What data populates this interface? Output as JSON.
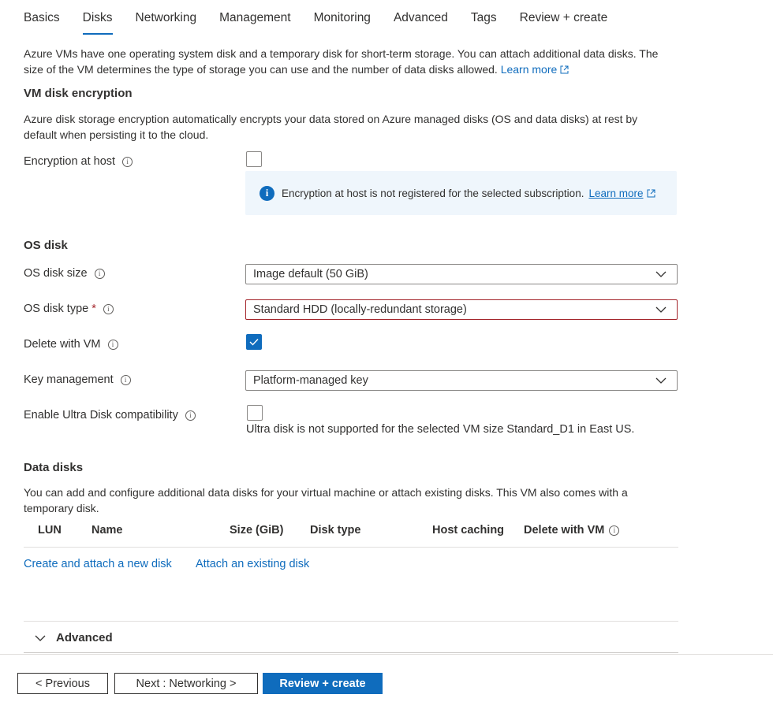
{
  "tabs": [
    {
      "label": "Basics"
    },
    {
      "label": "Disks"
    },
    {
      "label": "Networking"
    },
    {
      "label": "Management"
    },
    {
      "label": "Monitoring"
    },
    {
      "label": "Advanced"
    },
    {
      "label": "Tags"
    },
    {
      "label": "Review + create"
    }
  ],
  "active_tab": "Disks",
  "intro": {
    "text": "Azure VMs have one operating system disk and a temporary disk for short-term storage. You can attach additional data disks. The size of the VM determines the type of storage you can use and the number of data disks allowed.",
    "link": "Learn more"
  },
  "encryption": {
    "heading": "VM disk encryption",
    "description": "Azure disk storage encryption automatically encrypts your data stored on Azure managed disks (OS and data disks) at rest by default when persisting it to the cloud.",
    "host_label": "Encryption at host",
    "host_checked": false,
    "notice": "Encryption at host is not registered for the selected subscription.",
    "notice_link": "Learn more"
  },
  "os_disk": {
    "heading": "OS disk",
    "size_label": "OS disk size",
    "size_value": "Image default (50 GiB)",
    "type_label": "OS disk type",
    "type_required": "*",
    "type_value": "Standard HDD (locally-redundant storage)",
    "delete_label": "Delete with VM",
    "delete_checked": true,
    "key_label": "Key management",
    "key_value": "Platform-managed key",
    "ultra_label": "Enable Ultra Disk compatibility",
    "ultra_checked": false,
    "ultra_note": "Ultra disk is not supported for the selected VM size Standard_D1 in East US."
  },
  "data_disks": {
    "heading": "Data disks",
    "description": "You can add and configure additional data disks for your virtual machine or attach existing disks. This VM also comes with a temporary disk.",
    "columns": [
      "LUN",
      "Name",
      "Size (GiB)",
      "Disk type",
      "Host caching",
      "Delete with VM"
    ],
    "create_link": "Create and attach a new disk",
    "attach_link": "Attach an existing disk"
  },
  "advanced": {
    "label": "Advanced"
  },
  "footer": {
    "previous": "< Previous",
    "next": "Next : Networking >",
    "review": "Review + create"
  },
  "colors": {
    "accent": "#0f6cbd",
    "error": "#a4262c",
    "info_bg": "#eff6fc"
  }
}
